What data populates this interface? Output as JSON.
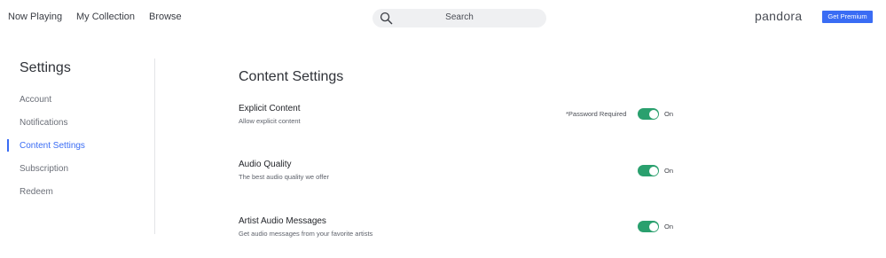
{
  "nav": {
    "links": [
      "Now Playing",
      "My Collection",
      "Browse"
    ],
    "search_placeholder": "Search",
    "logo": "pandora",
    "premium_label": "Get Premium"
  },
  "sidebar": {
    "title": "Settings",
    "items": [
      {
        "label": "Account"
      },
      {
        "label": "Notifications"
      },
      {
        "label": "Content Settings"
      },
      {
        "label": "Subscription"
      },
      {
        "label": "Redeem"
      }
    ],
    "active": "Content Settings"
  },
  "content": {
    "title": "Content Settings",
    "rows": [
      {
        "title": "Explicit Content",
        "subtitle": "Allow explicit content",
        "note": "*Password Required",
        "state": "On"
      },
      {
        "title": "Audio Quality",
        "subtitle": "The best audio quality we offer",
        "state": "On"
      },
      {
        "title": "Artist Audio Messages",
        "subtitle": "Get audio messages from your favorite artists",
        "state": "On"
      }
    ]
  },
  "colors": {
    "accent": "#3a6cf4",
    "toggle_on": "#2aa06e"
  },
  "icons": [
    "search-icon"
  ]
}
